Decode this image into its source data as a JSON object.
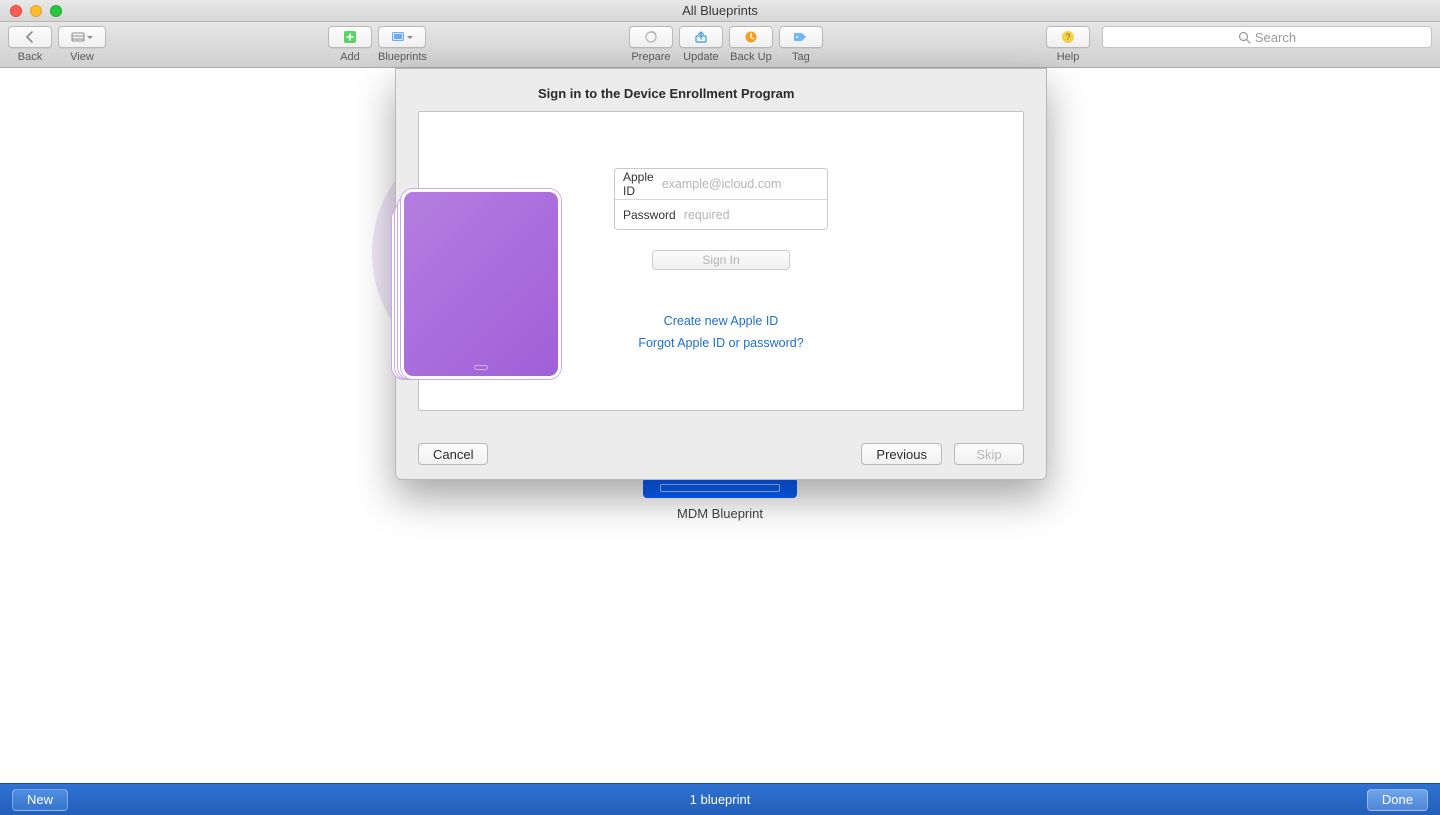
{
  "window": {
    "title": "All Blueprints"
  },
  "toolbar": {
    "back": "Back",
    "view": "View",
    "add": "Add",
    "blueprints": "Blueprints",
    "prepare": "Prepare",
    "update": "Update",
    "backup": "Back Up",
    "tag": "Tag",
    "help": "Help",
    "search_placeholder": "Search"
  },
  "dialog": {
    "heading": "Sign in to the Device Enrollment Program",
    "appleid_label": "Apple ID",
    "appleid_placeholder": "example@icloud.com",
    "password_label": "Password",
    "password_placeholder": "required",
    "signin": "Sign In",
    "create_link": "Create new Apple ID",
    "forgot_link": "Forgot Apple ID or password?",
    "cancel": "Cancel",
    "previous": "Previous",
    "skip": "Skip"
  },
  "main": {
    "blueprint_label": "MDM Blueprint"
  },
  "footer": {
    "new": "New",
    "count_text": "1 blueprint",
    "done": "Done"
  }
}
